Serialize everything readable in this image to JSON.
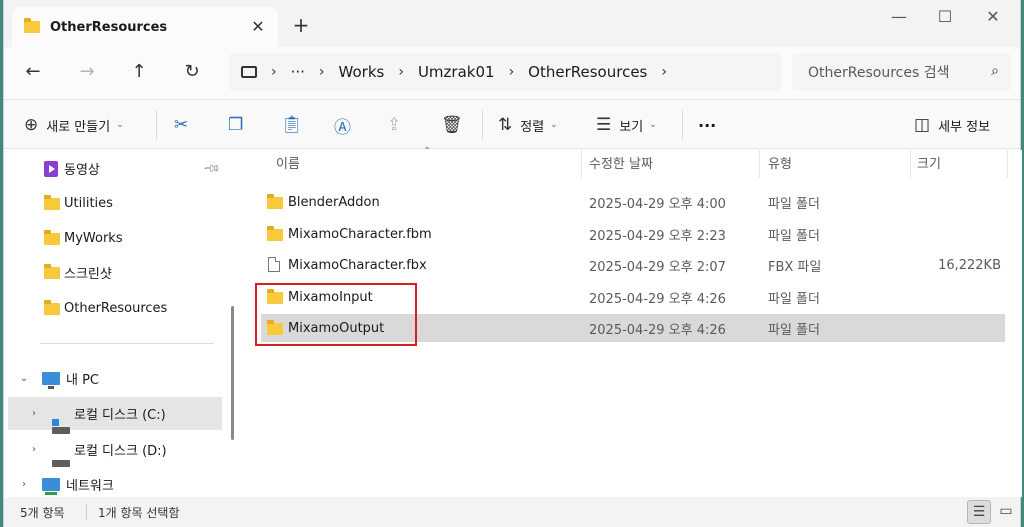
{
  "window": {
    "tab_title": "OtherResources",
    "tab_close": "✕",
    "new_tab": "+",
    "controls": {
      "minimize": "—",
      "maximize": "☐",
      "close": "✕"
    }
  },
  "nav": {
    "back": "←",
    "forward": "→",
    "up": "↑",
    "refresh": "↻",
    "breadcrumb": [
      "Works",
      "Umzrak01",
      "OtherResources"
    ],
    "ellipsis": "···",
    "search_placeholder": "OtherResources 검색"
  },
  "toolbar": {
    "new_label": "새로 만들기",
    "sort_label": "정렬",
    "view_label": "보기",
    "more_label": "···",
    "details_label": "세부 정보"
  },
  "sidebar": {
    "quick": [
      {
        "label": "동영상",
        "icon": "video-icon",
        "pinned": true
      },
      {
        "label": "Utilities",
        "icon": "folder-icon"
      },
      {
        "label": "MyWorks",
        "icon": "folder-icon"
      },
      {
        "label": "스크린샷",
        "icon": "folder-icon"
      },
      {
        "label": "OtherResources",
        "icon": "folder-icon"
      }
    ],
    "this_pc": "내 PC",
    "drive_c": "로컬 디스크 (C:)",
    "drive_d": "로컬 디스크 (D:)",
    "network": "네트워크"
  },
  "columns": {
    "name": "이름",
    "date": "수정한 날짜",
    "type": "유형",
    "size": "크기"
  },
  "files": [
    {
      "name": "BlenderAddon",
      "date": "2025-04-29 오후 4:00",
      "type": "파일 폴더",
      "size": "",
      "kind": "folder"
    },
    {
      "name": "MixamoCharacter.fbm",
      "date": "2025-04-29 오후 2:23",
      "type": "파일 폴더",
      "size": "",
      "kind": "folder"
    },
    {
      "name": "MixamoCharacter.fbx",
      "date": "2025-04-29 오후 2:07",
      "type": "FBX 파일",
      "size": "16,222KB",
      "kind": "file"
    },
    {
      "name": "MixamoInput",
      "date": "2025-04-29 오후 4:26",
      "type": "파일 폴더",
      "size": "",
      "kind": "folder"
    },
    {
      "name": "MixamoOutput",
      "date": "2025-04-29 오후 4:26",
      "type": "파일 폴더",
      "size": "",
      "kind": "folder",
      "selected": true
    }
  ],
  "status": {
    "count": "5개 항목",
    "selection": "1개 항목 선택함"
  },
  "colors": {
    "highlight": "#d62020",
    "folder": "#f8c93c",
    "accent": "#2a6fb5"
  }
}
